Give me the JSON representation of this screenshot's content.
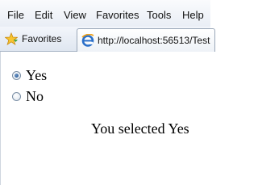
{
  "menu": [
    "File",
    "Edit",
    "View",
    "Favorites",
    "Tools",
    "Help"
  ],
  "favorites_bar": {
    "favorites_label": "Favorites",
    "tab_url": "http://localhost:56513/Test"
  },
  "form": {
    "options": [
      {
        "label": "Yes",
        "checked": true
      },
      {
        "label": "No",
        "checked": false
      }
    ],
    "result_text": "You selected Yes"
  }
}
